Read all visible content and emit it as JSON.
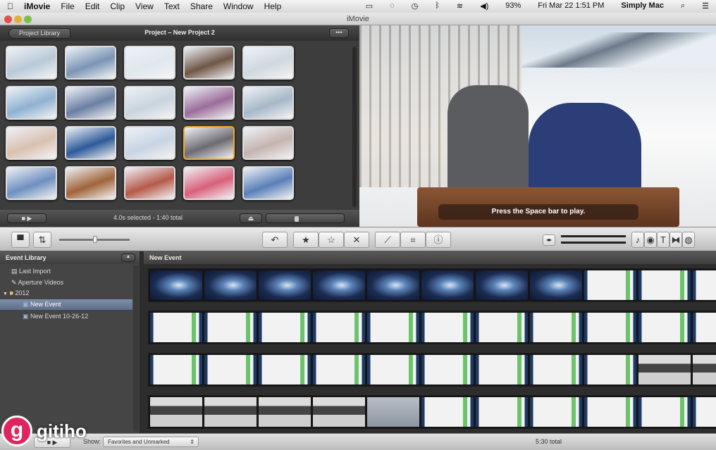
{
  "menubar": {
    "app": "iMovie",
    "items": [
      "File",
      "Edit",
      "Clip",
      "View",
      "Text",
      "Share",
      "Window",
      "Help"
    ],
    "battery": "93%",
    "datetime": "Fri Mar 22  1:51 PM",
    "user": "Simply Mac"
  },
  "window": {
    "title": "iMovie"
  },
  "project": {
    "back_label": "Project Library",
    "title": "Project – New Project 2",
    "more_label": "•••",
    "status": "4.0s selected - 1:40 total",
    "thumbnail_colors": [
      [
        "#b9c9d8",
        "#7a95b5",
        "#dfe7ee",
        "#6f5646",
        "#cfd8e0"
      ],
      [
        "#8fb1d1",
        "#6a7fa3",
        "#c8d4de",
        "#9a6d9a",
        "#a7b8c8"
      ],
      [
        "#d9c0b0",
        "#2e5a9a",
        "#c7d4e3",
        "#6d6b72",
        "#c4b4b0"
      ],
      [
        "#6f8fbf",
        "#a0643a",
        "#b55a4a",
        "#d8607a",
        "#5a7fb8"
      ]
    ],
    "selected_thumb": [
      2,
      3
    ]
  },
  "viewer": {
    "hint": "Press the Space bar to play."
  },
  "toolbar": {
    "left_icons": [
      "camera-icon",
      "swap-icon"
    ],
    "center": [
      "rotate-icon",
      "favorite-icon",
      "unmark-icon",
      "reject-icon",
      "keyword-icon",
      "crop-icon",
      "info-icon"
    ],
    "center_glyphs": [
      "↶",
      "★",
      "☆",
      "✕",
      "⟋",
      "⌗",
      "ⓘ"
    ],
    "right_glyphs": [
      "♪",
      "◉",
      "T",
      "⧓",
      "◍"
    ]
  },
  "event_library": {
    "title": "Event Library",
    "items": [
      {
        "label": "Last Import",
        "icon": "▤"
      },
      {
        "label": "Aperture Videos",
        "icon": "✎"
      },
      {
        "label": "2012",
        "icon": "▼"
      },
      {
        "label": "New Event",
        "icon": "▣",
        "selected": true
      },
      {
        "label": "New Event 10-26-12",
        "icon": "▣"
      }
    ]
  },
  "browser": {
    "title": "New Event",
    "rows": [
      [
        "galaxy",
        "galaxy",
        "galaxy",
        "galaxy",
        "galaxy",
        "galaxy",
        "galaxy",
        "galaxy",
        "web",
        "web",
        "web"
      ],
      [
        "web",
        "web",
        "web",
        "web",
        "web",
        "web",
        "web",
        "web",
        "web",
        "web",
        "web"
      ],
      [
        "web",
        "web",
        "web",
        "web",
        "web",
        "web",
        "web",
        "web",
        "web",
        "dark",
        "dark"
      ],
      [
        "dark",
        "dark",
        "dark",
        "dark",
        "gray",
        "web",
        "web",
        "web",
        "web",
        "web",
        "web"
      ]
    ]
  },
  "bottom": {
    "show_label": "Show:",
    "filter": "Favorites and Unmarked",
    "total": "5:30 total"
  },
  "watermark": {
    "text": "gitiho",
    "logo": "g"
  }
}
